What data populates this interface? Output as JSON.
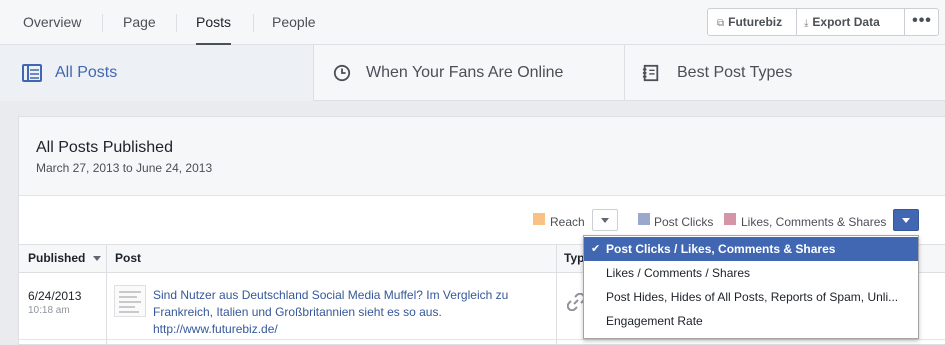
{
  "topnav": {
    "tabs": [
      "Overview",
      "Page",
      "Posts",
      "People"
    ],
    "active_tab": "Posts",
    "account_button": "Futurebiz",
    "export_button": "Export Data",
    "more_button": "•••"
  },
  "subnav": {
    "items": [
      "All Posts",
      "When Your Fans Are Online",
      "Best Post Types"
    ],
    "active_item": "All Posts"
  },
  "panel": {
    "title": "All Posts Published",
    "date_range": "March 27, 2013 to June 24, 2013"
  },
  "legend": {
    "reach": "Reach",
    "post_clicks": "Post Clicks",
    "likes": "Likes, Comments & Shares",
    "colors": {
      "reach": "#f7c282",
      "post_clicks": "#99a8cc",
      "likes": "#d695a7"
    }
  },
  "table": {
    "headers": {
      "published": "Published",
      "post": "Post",
      "type": "Typ"
    },
    "rows": [
      {
        "date": "6/24/2013",
        "time": "10:18 am",
        "text": "Sind Nutzer aus Deutschland Social Media Muffel? Im Vergleich zu Frankreich, Italien und Großbritannien sieht es so aus. http://www.futurebiz.de/",
        "type_icon": "link-icon"
      }
    ]
  },
  "menu": {
    "items": [
      "Post Clicks / Likes, Comments & Shares",
      "Likes / Comments / Shares",
      "Post Hides, Hides of All Posts, Reports of Spam, Unli...",
      "Engagement Rate"
    ],
    "selected": "Post Clicks / Likes, Comments & Shares",
    "check": "✔"
  },
  "colors": {
    "accent": "#4267b2",
    "link": "#365899"
  }
}
